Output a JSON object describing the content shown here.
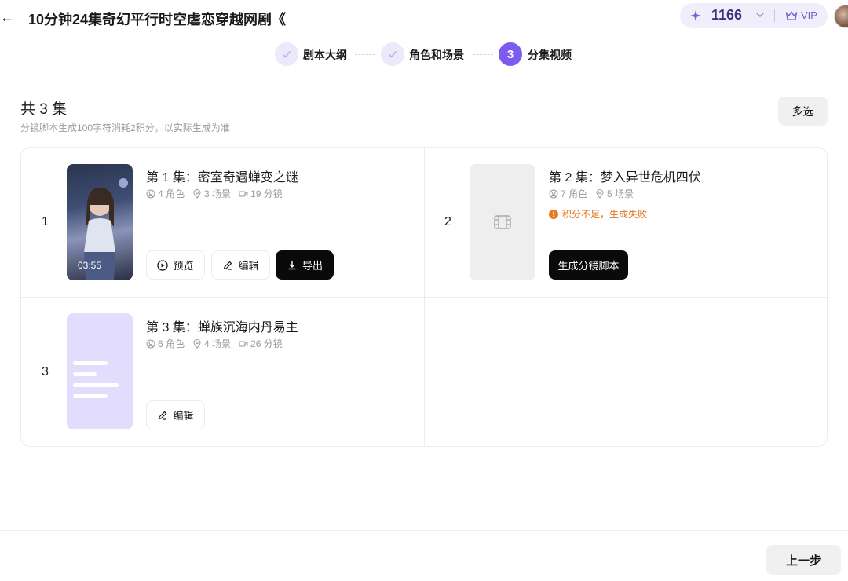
{
  "header": {
    "back_glyph": "←",
    "title": "10分钟24集奇幻平行时空虐恋穿越网剧《",
    "credits": "1166",
    "vip_label": "VIP"
  },
  "steps": [
    {
      "label": "剧本大纲",
      "state": "done"
    },
    {
      "label": "角色和场景",
      "state": "done"
    },
    {
      "label": "分集视频",
      "state": "active",
      "number": "3"
    }
  ],
  "section": {
    "total": "共 3 集",
    "note": "分镜脚本生成100字符消耗2积分，以实际生成为准",
    "multi_select": "多选"
  },
  "episodes": [
    {
      "index": "1",
      "title": "第 1 集：密室奇遇蝉变之谜",
      "roles": "4 角色",
      "scenes": "3 场景",
      "shots": "19 分镜",
      "duration": "03:55",
      "buttons": {
        "preview": "预览",
        "edit": "编辑",
        "export": "导出"
      }
    },
    {
      "index": "2",
      "title": "第 2 集：梦入异世危机四伏",
      "roles": "7 角色",
      "scenes": "5 场景",
      "error": "积分不足，生成失败",
      "buttons": {
        "generate": "生成分镜脚本"
      }
    },
    {
      "index": "3",
      "title": "第 3 集：蝉族沉海内丹易主",
      "roles": "6 角色",
      "scenes": "4 场景",
      "shots": "26 分镜",
      "buttons": {
        "edit": "编辑"
      }
    }
  ],
  "footer": {
    "prev": "上一步"
  },
  "colors": {
    "accent": "#7e5bef",
    "accent_light": "#ece9fb",
    "warning": "#e1751c",
    "dark_button": "#0a0a0a"
  }
}
